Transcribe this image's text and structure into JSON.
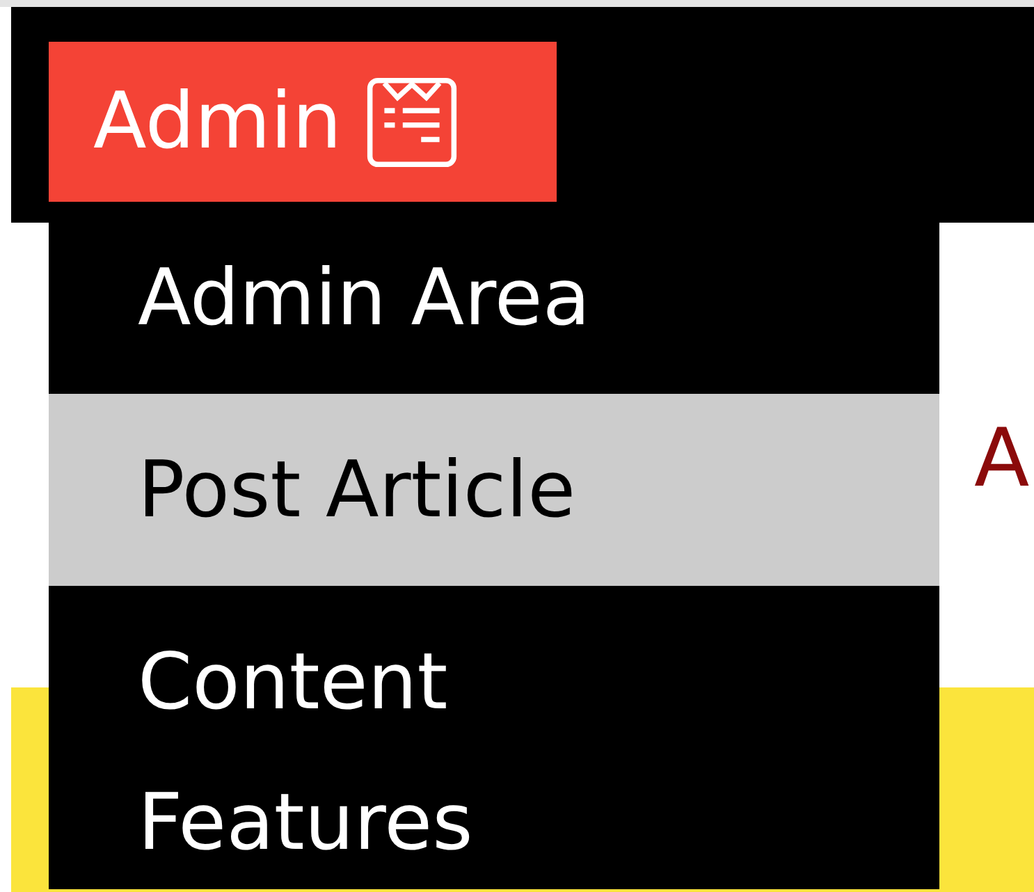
{
  "navbar": {
    "menu_button": {
      "label": "Admin"
    }
  },
  "dropdown": {
    "items": [
      {
        "label": "Admin Area",
        "selected": false
      },
      {
        "label": "Post Article",
        "selected": true
      },
      {
        "label": "Content",
        "selected": false
      },
      {
        "label": "Features",
        "selected": false
      }
    ]
  },
  "page": {
    "heading": "A"
  }
}
